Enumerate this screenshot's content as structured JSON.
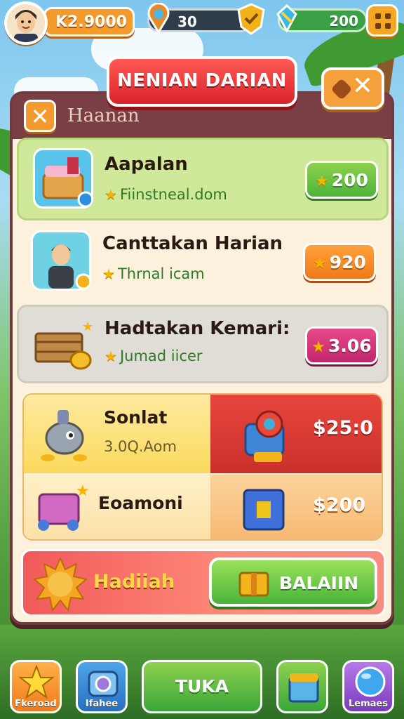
{
  "hud": {
    "coins": "K2.9000",
    "level_value": "30",
    "gems": "200"
  },
  "header": {
    "title": "NENIAN DARIAN",
    "panel_label": "Haanan"
  },
  "rows": [
    {
      "title": "Aapalan",
      "subtitle": "Fiinstneal.dom",
      "price": "200"
    },
    {
      "title": "Canttakan Harian",
      "subtitle": "Thrnal icam",
      "price": "920"
    },
    {
      "title": "Hadtakan Kemari:",
      "subtitle": "Jumad iicer",
      "price": "3.06"
    }
  ],
  "shop": [
    {
      "name": "Sonlat",
      "detail": "3.0Q.Aom",
      "price": "$25:0"
    },
    {
      "name": "Eoamoni",
      "price": "$200"
    }
  ],
  "reward": {
    "label": "Hadiiah",
    "button": "BALAIIN"
  },
  "nav": [
    {
      "label": "Fkeroad"
    },
    {
      "label": "Ifahee"
    },
    {
      "label": "TUKA"
    },
    {
      "label": ""
    },
    {
      "label": "Lemaes"
    }
  ],
  "colors": {
    "accent_red": "#d8232a",
    "price_green": "#4bb43a",
    "price_orange": "#f07a1a",
    "price_magenta": "#c2246a",
    "panel_border": "#6f3b3f"
  }
}
